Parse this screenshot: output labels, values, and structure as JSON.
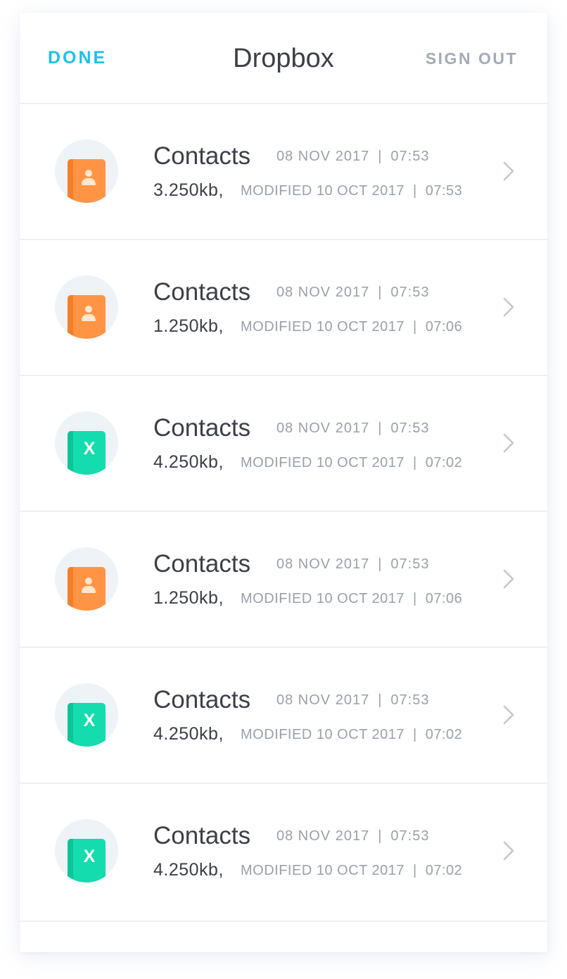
{
  "header": {
    "done_label": "DONE",
    "title": "Dropbox",
    "signout_label": "SIGN OUT"
  },
  "colors": {
    "accent": "#1cc1e8",
    "contact_icon": "#ff9544",
    "excel_icon": "#14dcae"
  },
  "files": [
    {
      "name": "Contacts",
      "date": "08 NOV 2017",
      "time": "07:53",
      "size": "3.250kb,",
      "modified_label": "MODIFIED 10 OCT 2017",
      "modified_time": "07:53",
      "icon": "contact-book-icon",
      "glyph": ""
    },
    {
      "name": "Contacts",
      "date": "08 NOV 2017",
      "time": "07:53",
      "size": "1.250kb,",
      "modified_label": "MODIFIED 10 OCT 2017",
      "modified_time": "07:06",
      "icon": "contact-book-icon",
      "glyph": ""
    },
    {
      "name": "Contacts",
      "date": "08 NOV 2017",
      "time": "07:53",
      "size": "4.250kb,",
      "modified_label": "MODIFIED 10 OCT 2017",
      "modified_time": "07:02",
      "icon": "excel-book-icon",
      "glyph": "X"
    },
    {
      "name": "Contacts",
      "date": "08 NOV 2017",
      "time": "07:53",
      "size": "1.250kb,",
      "modified_label": "MODIFIED 10 OCT 2017",
      "modified_time": "07:06",
      "icon": "contact-book-icon",
      "glyph": ""
    },
    {
      "name": "Contacts",
      "date": "08 NOV 2017",
      "time": "07:53",
      "size": "4.250kb,",
      "modified_label": "MODIFIED 10 OCT 2017",
      "modified_time": "07:02",
      "icon": "excel-book-icon",
      "glyph": "X"
    },
    {
      "name": "Contacts",
      "date": "08 NOV 2017",
      "time": "07:53",
      "size": "4.250kb,",
      "modified_label": "MODIFIED 10 OCT 2017",
      "modified_time": "07:02",
      "icon": "excel-book-icon",
      "glyph": "X"
    }
  ]
}
